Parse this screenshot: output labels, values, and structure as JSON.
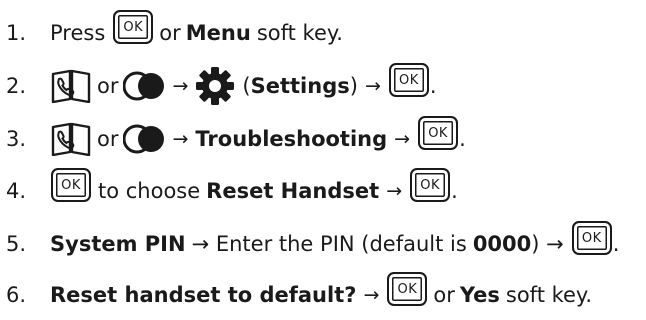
{
  "ok_label": "OK",
  "steps": [
    {
      "num": "1.",
      "t1": "Press",
      "t2": "or",
      "t3": "Menu",
      "t4": "soft key."
    },
    {
      "num": "2.",
      "t1": "or",
      "t2": "→",
      "t3": "(",
      "t4": "Settings",
      "t5": ")",
      "t6": "→",
      "t7": "."
    },
    {
      "num": "3.",
      "t1": "or",
      "t2": "→",
      "t3": "Troubleshooting",
      "t4": "→",
      "t5": "."
    },
    {
      "num": "4.",
      "t1": "to choose",
      "t2": "Reset Handset",
      "t3": "→",
      "t4": "."
    },
    {
      "num": "5.",
      "t1": "System PIN",
      "t2": "→ Enter the PIN (default is",
      "t3": "0000",
      "t4": ") →",
      "t5": "."
    },
    {
      "num": "6.",
      "t1": "Reset handset to default?",
      "t2": "→",
      "t3": "or",
      "t4": "Yes",
      "t5": "soft key."
    }
  ]
}
